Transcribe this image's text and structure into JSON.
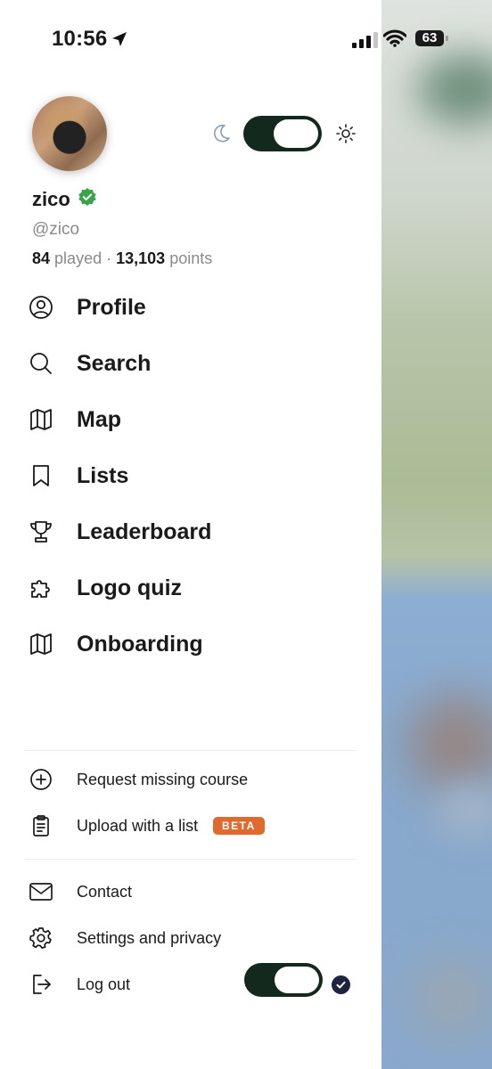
{
  "status_bar": {
    "time": "10:56",
    "battery": "63"
  },
  "profile": {
    "name": "zico",
    "handle": "@zico",
    "played_count": "84",
    "played_label": "played",
    "separator": "·",
    "points_count": "13,103",
    "points_label": "points"
  },
  "nav": {
    "items": [
      {
        "label": "Profile",
        "icon": "user-circle-icon"
      },
      {
        "label": "Search",
        "icon": "search-icon"
      },
      {
        "label": "Map",
        "icon": "map-icon"
      },
      {
        "label": "Lists",
        "icon": "bookmark-icon"
      },
      {
        "label": "Leaderboard",
        "icon": "trophy-icon"
      },
      {
        "label": "Logo quiz",
        "icon": "puzzle-icon"
      },
      {
        "label": "Onboarding",
        "icon": "map-icon"
      }
    ]
  },
  "secondary": {
    "request_missing_course": "Request missing course",
    "upload_with_list": "Upload with a list",
    "beta_badge": "BETA",
    "contact": "Contact",
    "settings_privacy": "Settings and privacy",
    "log_out": "Log out"
  },
  "colors": {
    "toggle_dark": "#14291d",
    "verified_green": "#3aa24b",
    "beta_orange": "#e0692e"
  }
}
